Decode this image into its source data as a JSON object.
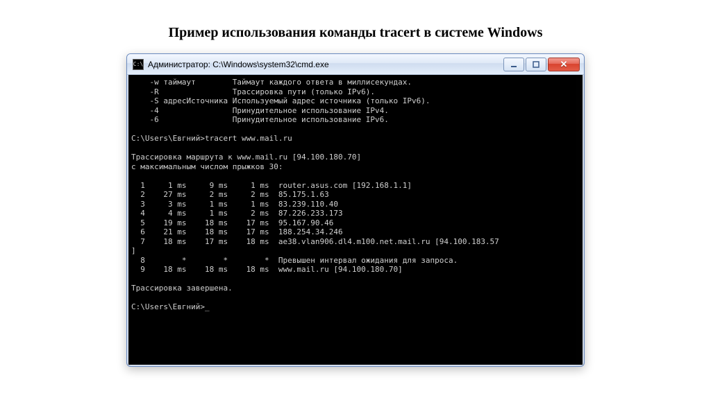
{
  "page": {
    "title": "Пример использования команды tracert в системе Windows"
  },
  "window": {
    "title": "Администратор: C:\\Windows\\system32\\cmd.exe"
  },
  "terminal": {
    "help_options": [
      {
        "flag": "-w",
        "arg": "таймаут",
        "desc": "Таймаут каждого ответа в миллисекундах."
      },
      {
        "flag": "-R",
        "arg": "",
        "desc": "Трассировка пути (только IPv6)."
      },
      {
        "flag": "-S",
        "arg": "адресИсточника",
        "desc": "Используемый адрес источника (только IPv6)."
      },
      {
        "flag": "-4",
        "arg": "",
        "desc": "Принудительное использование IPv4."
      },
      {
        "flag": "-6",
        "arg": "",
        "desc": "Принудительное использование IPv6."
      }
    ],
    "prompt1": "C:\\Users\\Евгний>",
    "command1": "tracert www.mail.ru",
    "trace_header_l1": "Трассировка маршрута к www.mail.ru [94.100.180.70]",
    "trace_header_l2": "с максимальным числом прыжков 30:",
    "hops": [
      {
        "n": "1",
        "t1": "1 ms",
        "t2": "9 ms",
        "t3": "1 ms",
        "host": "router.asus.com [192.168.1.1]"
      },
      {
        "n": "2",
        "t1": "27 ms",
        "t2": "2 ms",
        "t3": "2 ms",
        "host": "85.175.1.63"
      },
      {
        "n": "3",
        "t1": "3 ms",
        "t2": "1 ms",
        "t3": "1 ms",
        "host": "83.239.110.40"
      },
      {
        "n": "4",
        "t1": "4 ms",
        "t2": "1 ms",
        "t3": "2 ms",
        "host": "87.226.233.173"
      },
      {
        "n": "5",
        "t1": "19 ms",
        "t2": "18 ms",
        "t3": "17 ms",
        "host": "95.167.90.46"
      },
      {
        "n": "6",
        "t1": "21 ms",
        "t2": "18 ms",
        "t3": "17 ms",
        "host": "188.254.34.246"
      },
      {
        "n": "7",
        "t1": "18 ms",
        "t2": "17 ms",
        "t3": "18 ms",
        "host": "ae38.vlan906.dl4.m100.net.mail.ru [94.100.183.57"
      },
      {
        "n": "]",
        "t1": "",
        "t2": "",
        "t3": "",
        "host": ""
      },
      {
        "n": "8",
        "t1": "*",
        "t2": "*",
        "t3": "*",
        "host": "Превышен интервал ожидания для запроса."
      },
      {
        "n": "9",
        "t1": "18 ms",
        "t2": "18 ms",
        "t3": "18 ms",
        "host": "www.mail.ru [94.100.180.70]"
      }
    ],
    "trace_done": "Трассировка завершена.",
    "prompt2": "C:\\Users\\Евгний>"
  }
}
